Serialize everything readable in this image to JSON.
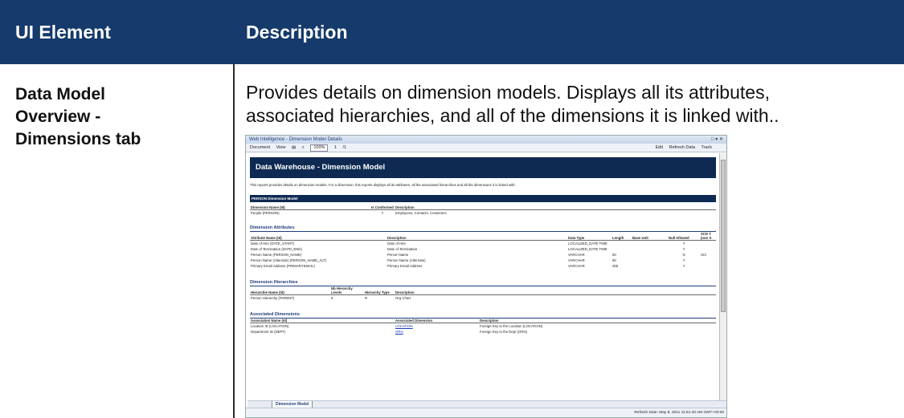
{
  "header": {
    "col1": "UI Element",
    "col2": "Description"
  },
  "row": {
    "label_line1": "Data Model",
    "label_line2": "Overview -",
    "label_line3": "Dimensions tab",
    "desc_line1": "Provides details on dimension models. Displays all its attributes,",
    "desc_line2": "associated hierarchies, and all of the dimensions it is linked with.."
  },
  "shot": {
    "window_title": "Web Intelligence - Dimension Model Details",
    "toolbar": {
      "document": "Document",
      "view": "View",
      "zoom": "100%",
      "page": "1",
      "page_total": "/1",
      "edit": "Edit",
      "refresh": "Refresh Data",
      "track": "Track"
    },
    "report_title": "Data Warehouse - Dimension Model",
    "intro": "This reports provides details on dimension models. For a dimension, this reports displays all its attributes, all the associated hierarchies and all the dimensions it is linked with.",
    "band": "PERSON Dimension Model",
    "dm_headers": [
      "Dimension Name (Id)",
      "Is Conformed",
      "Description"
    ],
    "dm_row": [
      "People (PERSON)",
      "Y",
      "Employees, Contacts, Customers"
    ],
    "attr_heading": "Dimension Attributes",
    "attr_headers": [
      "Attribute Name (Id)",
      "Description",
      "Data Type",
      "Length",
      "Base Unit",
      "Null Allowed",
      "SCD T (non S"
    ],
    "attr_rows": [
      [
        "Date of Hire (DATE_START)",
        "Date of Hire",
        "LOCALIZED_DATE TIME",
        "",
        "",
        "Y",
        ""
      ],
      [
        "Date of Termination (DATE_END)",
        "Date of Termination",
        "LOCALIZED_DATE TIME",
        "",
        "",
        "Y",
        ""
      ],
      [
        "Person Name (PERSON_NAME)",
        "Person Name",
        "VARCHAR",
        "60",
        "",
        "N",
        "SCI"
      ],
      [
        "Person Name (Alternate) (PERSON_NAME_ALT)",
        "Person Name (Alternate)",
        "VARCHAR",
        "60",
        "",
        "Y",
        ""
      ],
      [
        "Primary Email Address (PRIMARYEMAIL)",
        "Primary Email Address",
        "VARCHAR",
        "255",
        "",
        "Y",
        ""
      ]
    ],
    "hier_heading": "Dimension Hierarchies",
    "hier_headers": [
      "Hierarchie Name (Id)",
      "Nb Hierarchy Levels",
      "Hierarchy Type",
      "Description"
    ],
    "hier_row": [
      "Person Hierarchy (PARENT)",
      "5",
      "R",
      "Org Chart"
    ],
    "assoc_heading": "Associated Dimensions",
    "assoc_headers": [
      "Association Name (Id)",
      "Associated Dimension",
      "Description"
    ],
    "assoc_rows": [
      [
        "Location ID (LOCATION)",
        "LOCATION",
        "Foreign Key to the Location (LOCATION)"
      ],
      [
        "Department ID (DEPT)",
        "ORG",
        "Foreign Key to the Dept (ORG)"
      ]
    ],
    "tab_label": "Dimension Model",
    "status": "Refresh Date: May 8, 2011 11:51:43 AM GMT+03:00"
  }
}
